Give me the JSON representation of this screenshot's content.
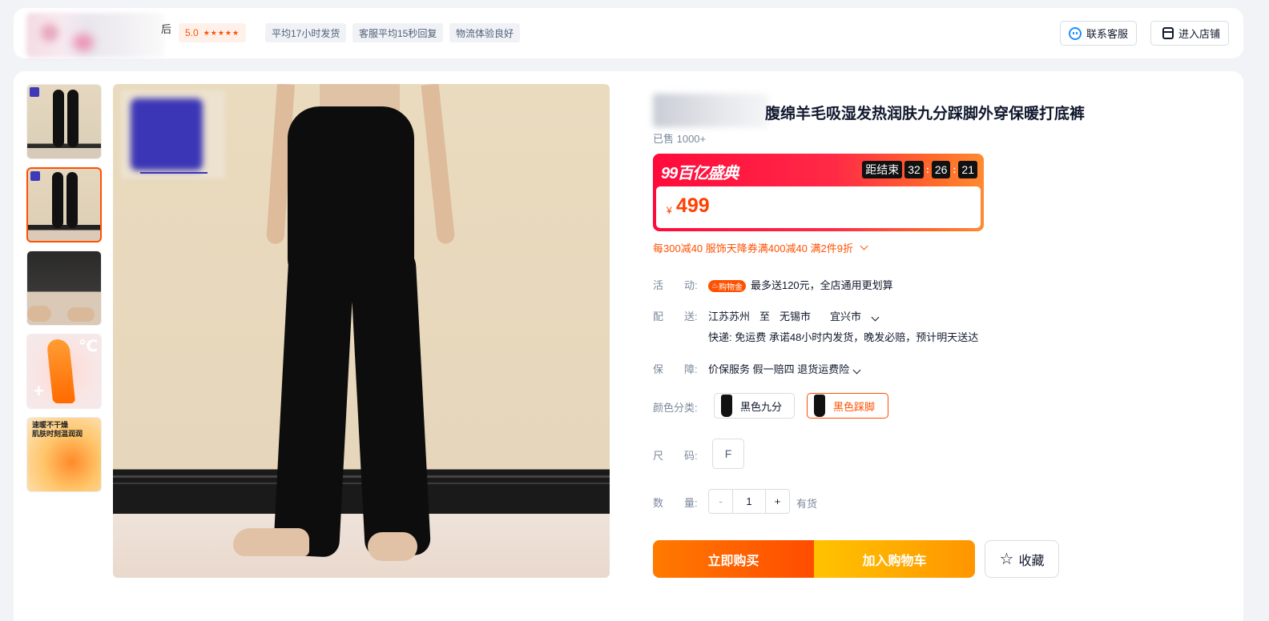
{
  "shop": {
    "name_fragment": "后",
    "rating": "5.0",
    "stars": "★★★★★",
    "service_tags": [
      "平均17小时发货",
      "客服平均15秒回复",
      "物流体验良好"
    ],
    "contact_label": "联系客服",
    "enter_store_label": "进入店铺"
  },
  "gallery": {
    "thumbnails": [
      {
        "name": "thumb-1",
        "active": false
      },
      {
        "name": "thumb-2",
        "active": true
      },
      {
        "name": "thumb-3",
        "active": false
      },
      {
        "name": "thumb-4",
        "active": false,
        "text": "℃"
      },
      {
        "name": "thumb-5",
        "active": false,
        "text": "速暖不干燥\n肌肤时刻温润润"
      }
    ]
  },
  "product": {
    "title": "腹绵羊毛吸湿发热润肤九分踩脚外穿保暖打底裤",
    "sold": "已售 1000+",
    "promo_logo": "99百亿盛典",
    "countdown": {
      "label": "距结束",
      "hours": "32",
      "minutes": "26",
      "seconds": "21"
    },
    "currency": "¥",
    "price": "499",
    "coupons": "每300减40 服饰天降券满400减40 满2件9折",
    "activity": {
      "label": "活　　动:",
      "tag": "购物金",
      "text": "最多送120元，全店通用更划算"
    },
    "delivery": {
      "label": "配　　送:",
      "from": "江苏苏州",
      "to_word": "至",
      "city": "无锡市",
      "district": "宜兴市",
      "detail": "快递: 免运费  承诺48小时内发货，晚发必赔，预计明天送达"
    },
    "guarantee": {
      "label": "保　　障:",
      "text": "价保服务 假一赔四 退货运费险"
    },
    "color": {
      "label": "颜色分类:",
      "options": [
        "黑色九分",
        "黑色踩脚"
      ],
      "selected": "黑色踩脚"
    },
    "size": {
      "label": "尺　　码:",
      "value": "F"
    },
    "quantity": {
      "label": "数　　量:",
      "minus": "-",
      "value": "1",
      "plus": "+",
      "stock": "有货"
    },
    "buy_now": "立即购买",
    "add_to_cart": "加入购物车",
    "favorite": "收藏"
  },
  "colors": {
    "accent": "#ff5000",
    "promo_red": "#ff0a3c",
    "link_blue": "#1e8fff"
  }
}
